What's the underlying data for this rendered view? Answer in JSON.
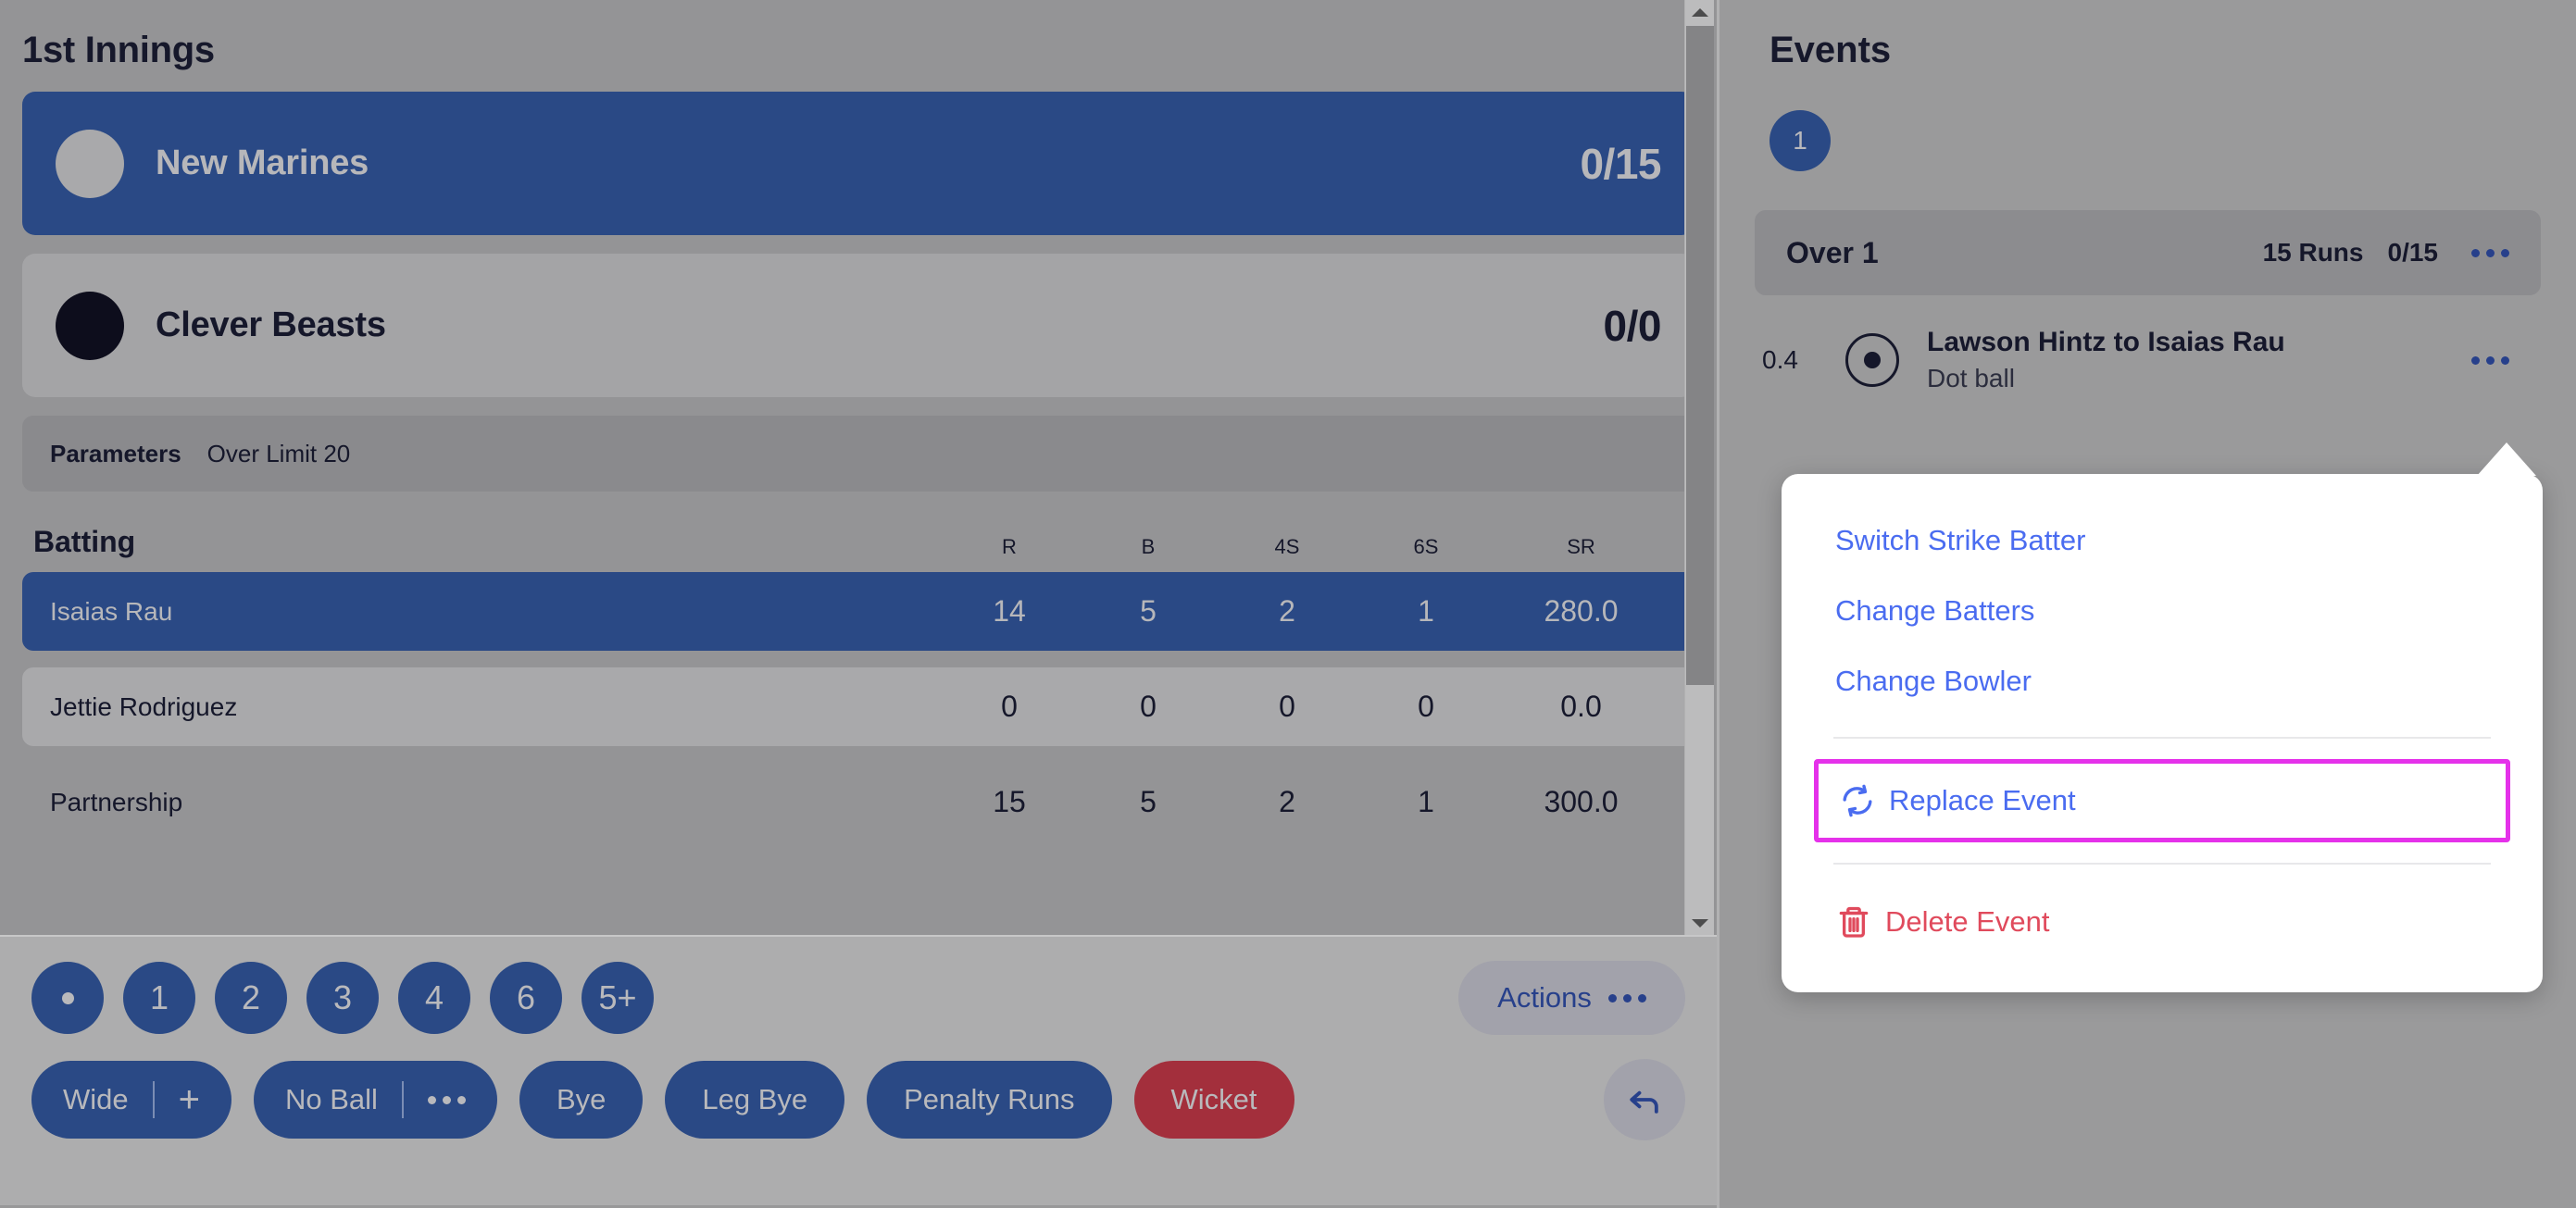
{
  "left": {
    "innings_title": "1st Innings",
    "teams": [
      {
        "name": "New Marines",
        "score": "0/15",
        "logo": "team-logo-grey",
        "state": "batting"
      },
      {
        "name": "Clever Beasts",
        "score": "0/0",
        "logo": "team-logo-dark",
        "state": "fielding"
      }
    ],
    "parameters": {
      "label": "Parameters",
      "value": "Over Limit 20"
    },
    "batting": {
      "title": "Batting",
      "columns": [
        "R",
        "B",
        "4S",
        "6S",
        "SR"
      ],
      "rows": [
        {
          "name": "Isaias Rau",
          "values": [
            "14",
            "5",
            "2",
            "1",
            "280.0"
          ],
          "highlight": true
        },
        {
          "name": "Jettie Rodriguez",
          "values": [
            "0",
            "0",
            "0",
            "0",
            "0.0"
          ],
          "highlight": false
        },
        {
          "name": "Partnership",
          "values": [
            "15",
            "5",
            "2",
            "1",
            "300.0"
          ],
          "highlight": false
        }
      ]
    },
    "toolbar": {
      "runs": [
        "dot",
        "1",
        "2",
        "3",
        "4",
        "6",
        "5+"
      ],
      "actions_label": "Actions",
      "actions_icon": "ellipsis-icon",
      "extras": [
        {
          "label": "Wide",
          "secondary": "+",
          "kind": "split-plus"
        },
        {
          "label": "No Ball",
          "secondary": "…",
          "kind": "split-dots"
        },
        {
          "label": "Bye",
          "kind": "plain"
        },
        {
          "label": "Leg Bye",
          "kind": "plain"
        },
        {
          "label": "Penalty Runs",
          "kind": "plain"
        },
        {
          "label": "Wicket",
          "kind": "danger"
        }
      ],
      "undo_icon": "undo-arrow-icon"
    }
  },
  "right": {
    "events_title": "Events",
    "over_badges": [
      "1"
    ],
    "over_header": {
      "label": "Over 1",
      "runs": "15 Runs",
      "score": "0/15",
      "menu_icon": "ellipsis-icon"
    },
    "events": [
      {
        "ball": "0.4",
        "ball_icon": "dot-ball-icon",
        "title": "Lawson Hintz to Isaias Rau",
        "subtitle": "Dot ball",
        "menu_icon": "ellipsis-icon"
      }
    ]
  },
  "context_menu": {
    "items": [
      {
        "label": "Switch Strike Batter",
        "icon": null,
        "kind": "link"
      },
      {
        "label": "Change Batters",
        "icon": null,
        "kind": "link"
      },
      {
        "label": "Change Bowler",
        "icon": null,
        "kind": "link"
      },
      {
        "label": "Replace Event",
        "icon": "refresh-icon",
        "kind": "link",
        "highlighted": true
      },
      {
        "label": "Delete Event",
        "icon": "trash-icon",
        "kind": "danger"
      }
    ]
  },
  "colors": {
    "primary_blue": "#2a4985",
    "link_blue": "#4a6cf0",
    "danger_red": "#e04a5c",
    "wicket_red": "#a32f3c",
    "highlight_magenta": "#e531ea",
    "panel_grey": "#989899",
    "toolbar_grey": "#adadae"
  }
}
